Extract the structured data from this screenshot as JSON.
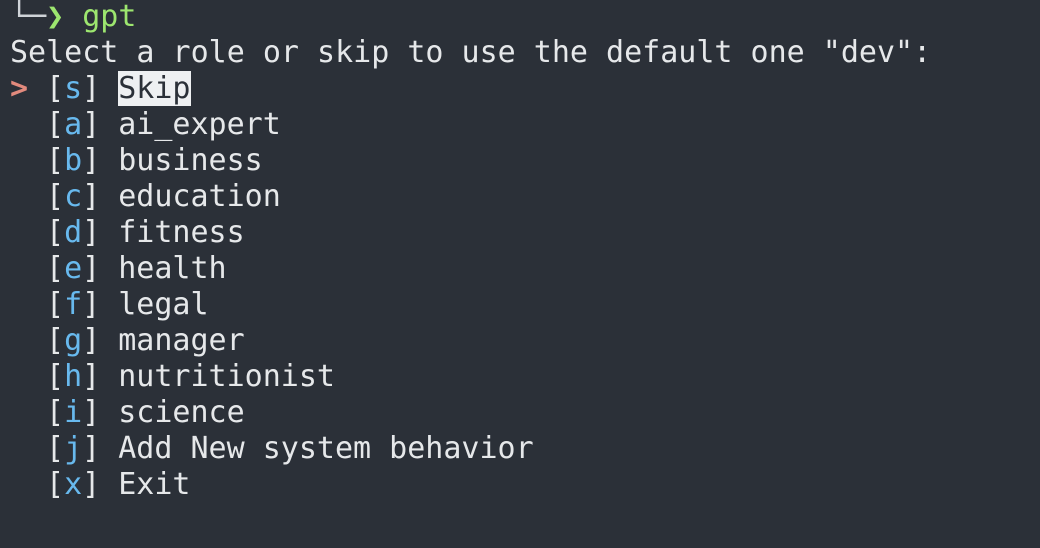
{
  "prompt": {
    "tree_glyph": "└─",
    "arrow_glyph": "❯",
    "command": "gpt"
  },
  "question": "Select a role or skip to use the default one \"dev\":",
  "cursor_glyph": ">",
  "bracket_open": "[",
  "bracket_close": "]",
  "options": [
    {
      "key": "s",
      "label": "Skip"
    },
    {
      "key": "a",
      "label": "ai_expert"
    },
    {
      "key": "b",
      "label": "business"
    },
    {
      "key": "c",
      "label": "education"
    },
    {
      "key": "d",
      "label": "fitness"
    },
    {
      "key": "e",
      "label": "health"
    },
    {
      "key": "f",
      "label": "legal"
    },
    {
      "key": "g",
      "label": "manager"
    },
    {
      "key": "h",
      "label": "nutritionist"
    },
    {
      "key": "i",
      "label": "science"
    },
    {
      "key": "j",
      "label": "Add New system behavior"
    },
    {
      "key": "x",
      "label": "Exit"
    }
  ],
  "colors": {
    "background": "#2b3038",
    "text": "#e6e8ea",
    "prompt_green": "#9de66f",
    "key_blue": "#68b9ee",
    "cursor_salmon": "#e28a7d"
  }
}
